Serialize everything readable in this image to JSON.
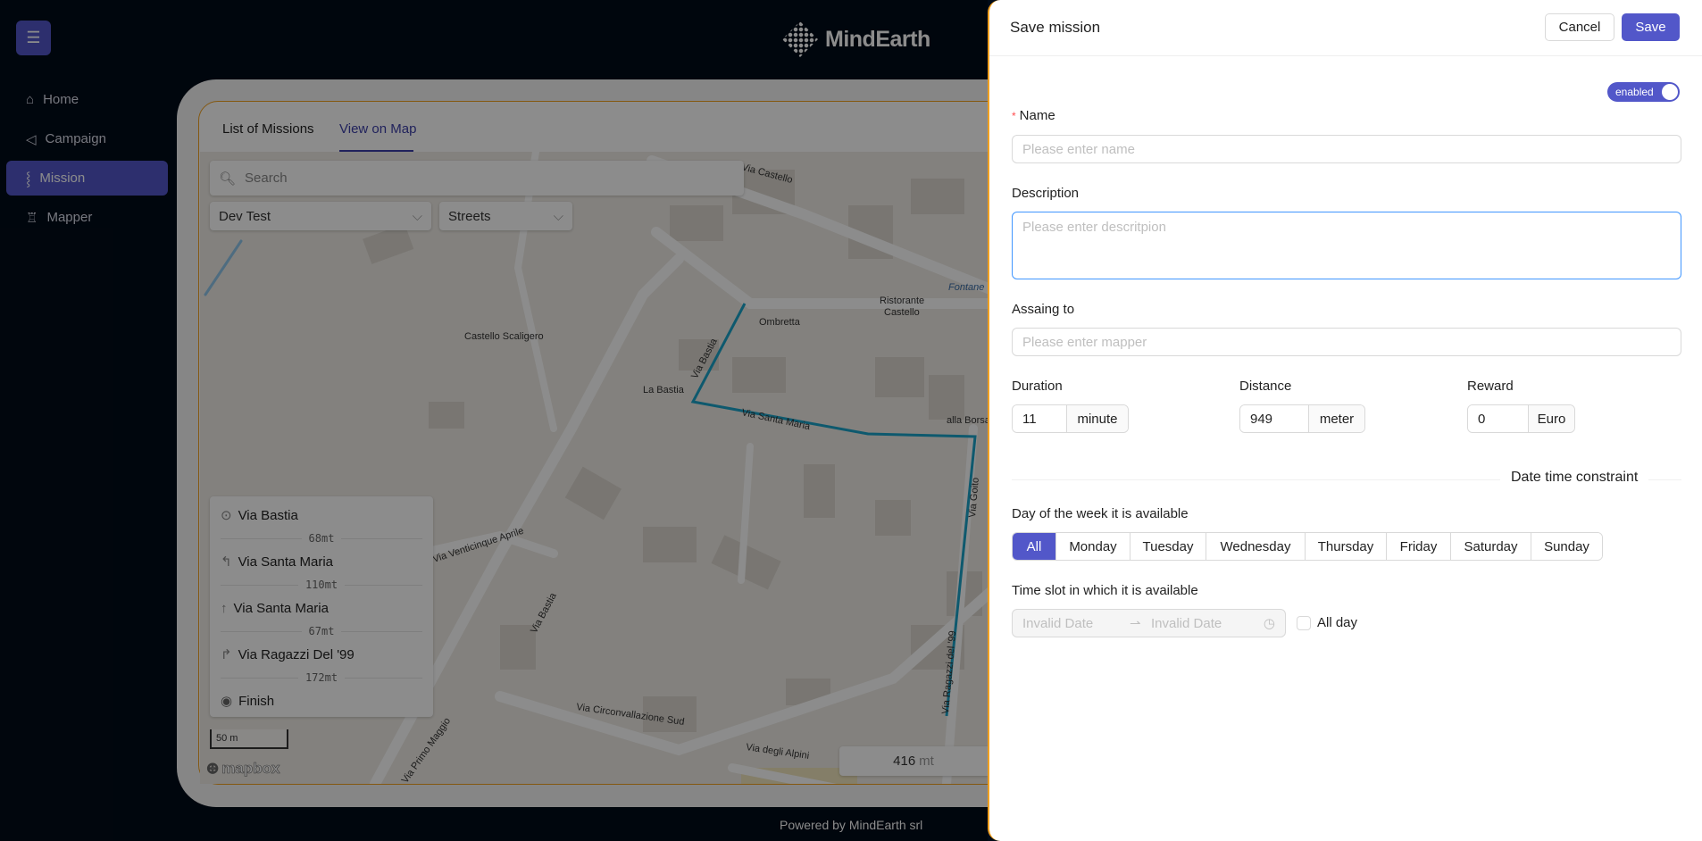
{
  "app": {
    "brand": "MindEarth",
    "footer": "Powered by MindEarth srl"
  },
  "sidebar": {
    "items": [
      {
        "label": "Home",
        "icon": "home-icon"
      },
      {
        "label": "Campaign",
        "icon": "megaphone-icon"
      },
      {
        "label": "Mission",
        "icon": "route-icon",
        "active": true
      },
      {
        "label": "Mapper",
        "icon": "shirt-icon"
      }
    ]
  },
  "tabs": [
    {
      "label": "List of Missions"
    },
    {
      "label": "View on Map",
      "active": true
    }
  ],
  "map": {
    "search_placeholder": "Search",
    "campaign_select": "Dev Test",
    "style_select": "Streets",
    "directions": [
      {
        "icon": "start",
        "street": "Via Bastia",
        "distance": "68mt"
      },
      {
        "icon": "turn-left",
        "street": "Via Santa Maria",
        "distance": "110mt"
      },
      {
        "icon": "straight",
        "street": "Via Santa Maria",
        "distance": "67mt"
      },
      {
        "icon": "turn-right",
        "street": "Via Ragazzi Del '99",
        "distance": "172mt"
      },
      {
        "icon": "finish",
        "street": "Finish"
      }
    ],
    "scale": "50 m",
    "attribution": "mapbox",
    "total_distance": "416",
    "total_unit": "mt",
    "route_color": "#1aa3c8",
    "labels": {
      "via_castello": "Via Castello",
      "fontane": "Fontane",
      "ristorante": "Ristorante",
      "castello": "Castello",
      "ombretta": "Ombretta",
      "castello_scaligero": "Castello Scaligero",
      "la_bastia": "La Bastia",
      "via_bastia": "Via Bastia",
      "via_santa_maria": "Via Santa Maria",
      "alla_borsa": "alla Borsa",
      "via_goito": "Via Goito",
      "via_venticinque": "Via Venticinque Aprile",
      "via_bastia2": "Via Bastia",
      "via_ragazzi": "Via Ragazzi del '99",
      "via_circ": "Via Circonvallazione Sud",
      "via_alpini": "Via degli Alpini",
      "via_primo": "Via Primo Maggio"
    }
  },
  "drawer": {
    "title": "Save mission",
    "cancel": "Cancel",
    "save": "Save",
    "toggle": "enabled",
    "toggle_on": true,
    "name_label": "Name",
    "name_placeholder": "Please enter name",
    "desc_label": "Description",
    "desc_placeholder": "Please enter descritpion",
    "assign_label": "Assaing to",
    "assign_placeholder": "Please enter mapper",
    "duration": {
      "label": "Duration",
      "value": "11",
      "unit": "minute"
    },
    "distance": {
      "label": "Distance",
      "value": "949",
      "unit": "meter"
    },
    "reward": {
      "label": "Reward",
      "value": "0",
      "unit": "Euro"
    },
    "section": "Date time constraint",
    "days_label": "Day of the week it is available",
    "days": [
      "All",
      "Monday",
      "Tuesday",
      "Wednesday",
      "Thursday",
      "Friday",
      "Saturday",
      "Sunday"
    ],
    "days_selected": "All",
    "slot_label": "Time slot in which it is available",
    "slot_start": "Invalid Date",
    "slot_end": "Invalid Date",
    "allday": "All day",
    "allday_checked": false,
    "accent": "#5257c9"
  }
}
